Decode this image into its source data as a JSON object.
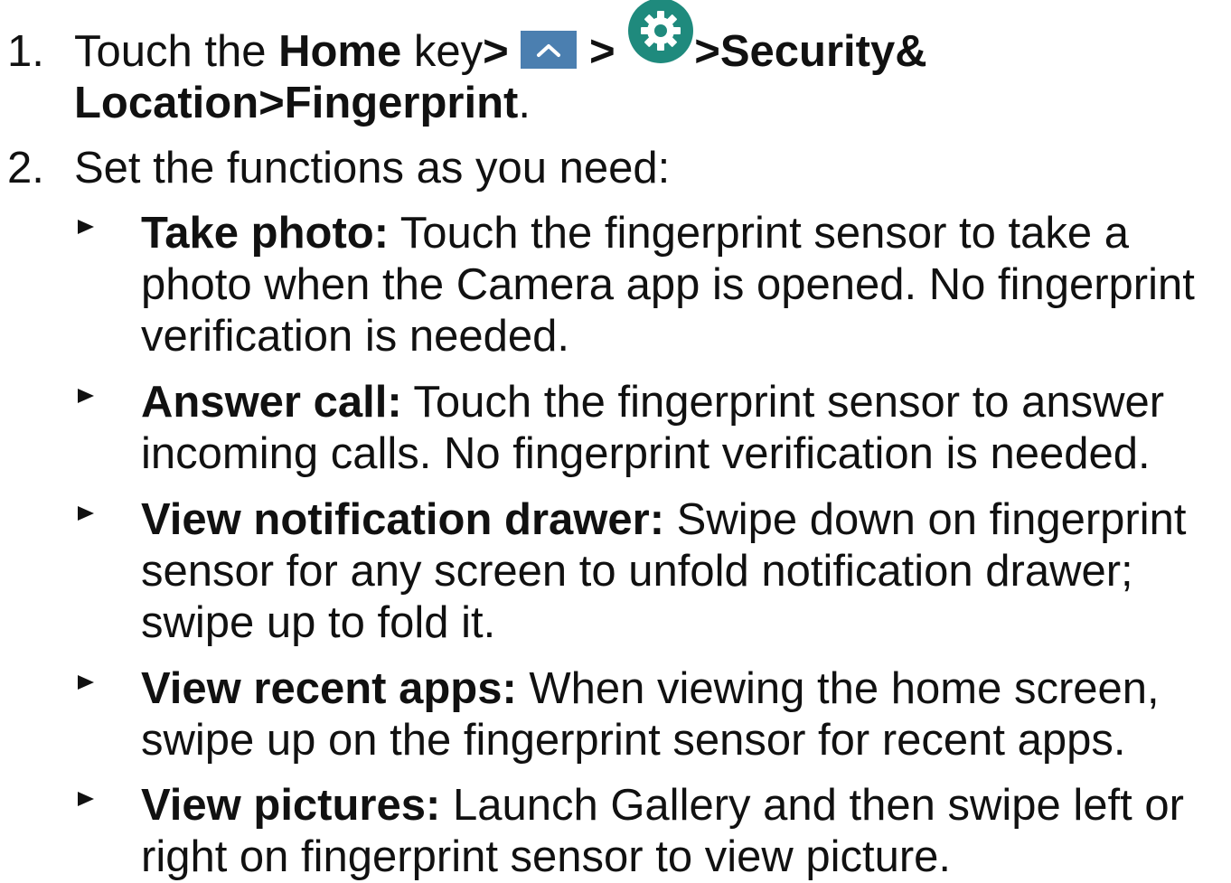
{
  "step1": {
    "number": "1.",
    "text_before": "Touch the ",
    "home": "Home",
    "key": " key",
    "sep1": "> ",
    "sep2": "> ",
    "path_end": ">Security& Location>Fingerprint",
    "period": ".",
    "icons": [
      "chevron-up-icon",
      "settings-gear-icon"
    ]
  },
  "step2": {
    "number": "2.",
    "text": "Set the functions as you need:"
  },
  "bullets": [
    {
      "term": "Take photo:",
      "desc": " Touch the fingerprint sensor to take a photo when the Camera app is opened. No fingerprint verification is needed."
    },
    {
      "term": "Answer call:",
      "desc": " Touch the fingerprint sensor to answer incoming calls. No fingerprint verification is needed."
    },
    {
      "term": "View notification drawer:",
      "desc": " Swipe down on fingerprint sensor for any screen to unfold notification drawer; swipe up to fold it."
    },
    {
      "term": "View recent apps:",
      "desc": " When viewing the home screen, swipe up on the fingerprint sensor for recent apps."
    },
    {
      "term": "View pictures:",
      "desc": " Launch Gallery and then swipe left or right on fingerprint sensor to view picture."
    }
  ],
  "colors": {
    "text": "#111111",
    "up_icon_bg": "#4b7fb0",
    "gear_icon_bg": "#1f8a7d"
  }
}
